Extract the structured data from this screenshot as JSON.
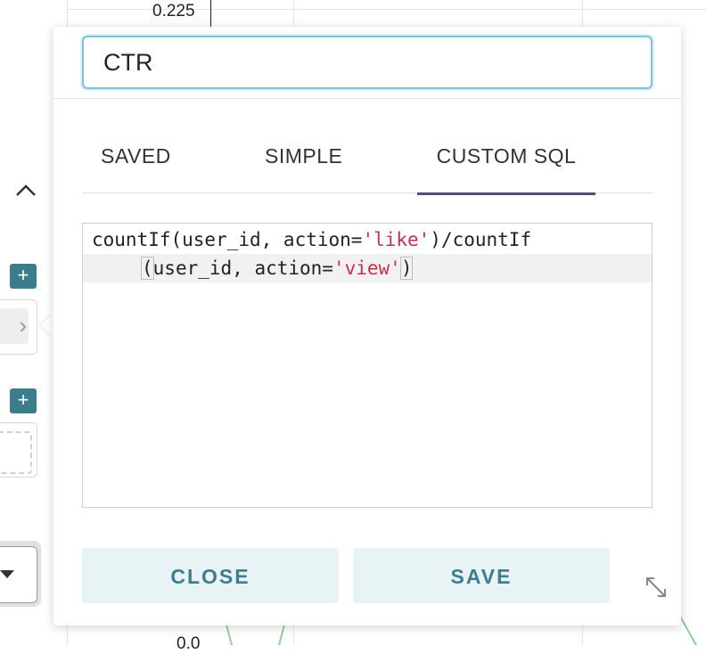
{
  "background": {
    "axis_top_label": "0.225",
    "axis_bottom_label": "0.0",
    "collapse_icon": "chevron-up-icon",
    "add_icon": "plus-icon"
  },
  "popover": {
    "name_value": "CTR",
    "tabs": [
      {
        "label": "SAVED",
        "active": false
      },
      {
        "label": "SIMPLE",
        "active": false
      },
      {
        "label": "CUSTOM SQL",
        "active": true
      }
    ],
    "sql": {
      "line1_a": "countIf(user_id, action=",
      "line1_str": "'like'",
      "line1_b": ")/countIf",
      "line2_bracket_open": "(",
      "line2_a": "user_id, action=",
      "line2_str": "'view'",
      "line2_bracket_close": ")"
    },
    "close_label": "CLOSE",
    "save_label": "SAVE",
    "resize_icon": "expand-icon"
  },
  "colors": {
    "accent": "#3d7d8f",
    "button_bg": "#e8f3f6",
    "tab_underline": "#4a5078",
    "sql_string": "#c0334d",
    "input_focus": "#7fc3d6"
  }
}
